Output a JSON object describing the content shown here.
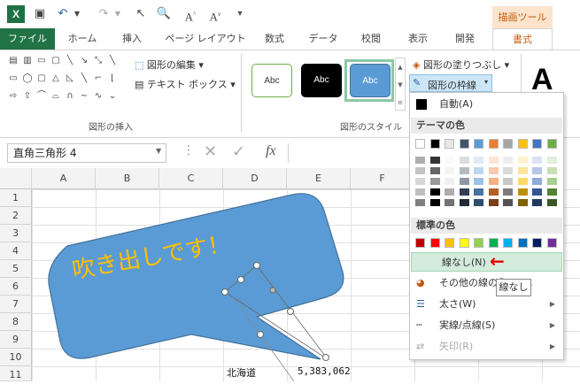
{
  "qat": {
    "logo": "X",
    "drawing_tools": "描画ツール"
  },
  "tabs": [
    "ファイル",
    "ホーム",
    "挿入",
    "ページ レイアウト",
    "数式",
    "データ",
    "校閲",
    "表示",
    "開発",
    "書式"
  ],
  "ribbon": {
    "edit_shape": "図形の編集",
    "text_box": "テキスト ボックス",
    "insert_shapes_label": "図形の挿入",
    "style_sample": "Abc",
    "shape_styles_label": "図形のスタイル",
    "shape_fill": "図形の塗りつぶし",
    "shape_outline": "図形の枠線",
    "wordart_letter": "A"
  },
  "formula_bar": {
    "name_box": "直角三角形 4",
    "fx": "fx"
  },
  "grid": {
    "columns": [
      "A",
      "B",
      "C",
      "D",
      "E",
      "F"
    ],
    "rows": [
      "1",
      "2",
      "3",
      "4",
      "5",
      "6",
      "7",
      "8",
      "9",
      "10",
      "11",
      "12"
    ],
    "callout_text": "吹き出しです！",
    "cell_d12": "北海道",
    "cell_e12": "5,383,062"
  },
  "menu": {
    "automatic": "自動(A)",
    "theme_colors_header": "テーマの色",
    "standard_colors_header": "標準の色",
    "no_outline": "線なし(N)",
    "more_colors": "その他の線の色(M)...",
    "weight": "太さ(W)",
    "dashes": "実線/点線(S)",
    "arrows": "矢印(R)",
    "theme_top": [
      "#ffffff",
      "#000000",
      "#e7e6e6",
      "#44546a",
      "#5b9bd5",
      "#ed7d31",
      "#a5a5a5",
      "#ffc000",
      "#4472c4",
      "#70ad47"
    ],
    "standard": [
      "#c00000",
      "#ff0000",
      "#ffc000",
      "#ffff00",
      "#92d050",
      "#00b050",
      "#00b0f0",
      "#0070c0",
      "#002060",
      "#7030a0"
    ]
  },
  "tooltip": "線なし",
  "colors": {
    "excel_green": "#217346",
    "accent_orange": "#c55a11",
    "callout_blue": "#5b9bd5",
    "callout_text": "#ffc000",
    "red_arrow": "#e00000"
  }
}
